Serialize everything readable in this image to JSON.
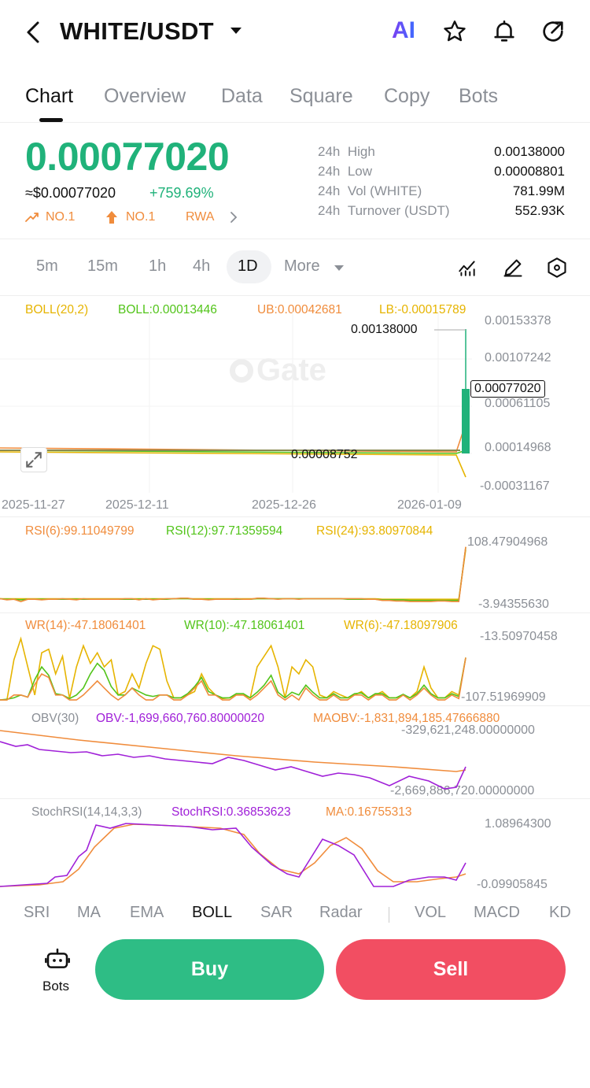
{
  "header": {
    "title": "WHITE/USDT",
    "ai_label": "AI"
  },
  "tabs": [
    {
      "label": "Chart"
    },
    {
      "label": "Overview"
    },
    {
      "label": "Data"
    },
    {
      "label": "Square"
    },
    {
      "label": "Copy"
    },
    {
      "label": "Bots"
    }
  ],
  "ticker": {
    "price": "0.00077020",
    "usd": "≈$0.00077020",
    "change": "+759.69%",
    "badges": [
      "NO.1",
      "NO.1",
      "RWA"
    ],
    "stats": [
      {
        "period": "24h",
        "label": "High",
        "value": "0.00138000"
      },
      {
        "period": "24h",
        "label": "Low",
        "value": "0.00008801"
      },
      {
        "period": "24h",
        "label": "Vol (WHITE)",
        "value": "781.99M"
      },
      {
        "period": "24h",
        "label": "Turnover (USDT)",
        "value": "552.93K"
      }
    ]
  },
  "timeframes": [
    "5m",
    "15m",
    "1h",
    "4h",
    "1D",
    "More"
  ],
  "main_chart": {
    "legend": {
      "name": "BOLL(20,2)",
      "boll": "BOLL:0.00013446",
      "ub": "UB:0.00042681",
      "lb": "LB:-0.00015789"
    },
    "watermark": "Gate",
    "y_ticks": [
      "0.00153378",
      "0.00107242",
      "0.00061105",
      "0.00014968",
      "-0.00031167"
    ],
    "high_label": "0.00138000",
    "low_label": "0.00008752",
    "current_label": "0.00077020",
    "x_ticks": [
      "2025-11-27",
      "2025-12-11",
      "2025-12-26",
      "2026-01-09"
    ]
  },
  "rsi": {
    "rsi6": "RSI(6):99.11049799",
    "rsi12": "RSI(12):97.71359594",
    "rsi24": "RSI(24):93.80970844",
    "max": "108.47904968",
    "min": "-3.94355630"
  },
  "wr": {
    "wr14": "WR(14):-47.18061401",
    "wr10": "WR(10):-47.18061401",
    "wr6": "WR(6):-47.18097906",
    "max": "-13.50970458",
    "min": "-107.51969909"
  },
  "obv": {
    "name": "OBV(30)",
    "obv": "OBV:-1,699,660,760.80000020",
    "maobv": "MAOBV:-1,831,894,185.47666880",
    "max": "-329,621,248.00000000",
    "min": "-2,669,886,720.00000000"
  },
  "stoch": {
    "name": "StochRSI(14,14,3,3)",
    "value": "StochRSI:0.36853623",
    "ma": "MA:0.16755313",
    "max": "1.08964300",
    "min": "-0.09905845"
  },
  "indicator_tabs": [
    "SRI",
    "MA",
    "EMA",
    "BOLL",
    "SAR",
    "Radar",
    "VOL",
    "MACD",
    "KD"
  ],
  "footer": {
    "bots": "Bots",
    "buy": "Buy",
    "sell": "Sell"
  },
  "colors": {
    "green": "#20b27a",
    "red": "#f24e62",
    "orange": "#f08c3c",
    "yellow": "#e6b400",
    "lime": "#52c41a",
    "purple": "#a020d8"
  },
  "series": {
    "rsi6": [
      9,
      7,
      8,
      4,
      8,
      8,
      7,
      8,
      8,
      9,
      8,
      7,
      9,
      8,
      8,
      8,
      8,
      8,
      9,
      9,
      7,
      9,
      7,
      8,
      9,
      9,
      10,
      10,
      8,
      8,
      7,
      8,
      8,
      8,
      9,
      8,
      8,
      10,
      10,
      9,
      8,
      9,
      9,
      8,
      9,
      9,
      9,
      9,
      9,
      9,
      9,
      9,
      9,
      8,
      8,
      6,
      6,
      5,
      5,
      4,
      4,
      4,
      4,
      5,
      5,
      4,
      4,
      99
    ],
    "rsi12": [
      9,
      8,
      8,
      7,
      8,
      8,
      8,
      8,
      8,
      8,
      8,
      8,
      8,
      8,
      8,
      8,
      8,
      8,
      8,
      8,
      8,
      8,
      8,
      8,
      8,
      9,
      9,
      9,
      8,
      8,
      8,
      8,
      8,
      8,
      8,
      8,
      8,
      9,
      9,
      9,
      9,
      9,
      9,
      9,
      9,
      9,
      9,
      9,
      9,
      9,
      8,
      8,
      8,
      8,
      8,
      7,
      7,
      7,
      7,
      6,
      6,
      6,
      6,
      6,
      6,
      6,
      6,
      98
    ],
    "rsi24": [
      9,
      9,
      9,
      9,
      9,
      9,
      9,
      9,
      9,
      9,
      9,
      9,
      9,
      9,
      9,
      9,
      9,
      9,
      9,
      9,
      9,
      9,
      9,
      9,
      9,
      9,
      9,
      9,
      9,
      9,
      9,
      9,
      9,
      9,
      9,
      9,
      9,
      9,
      9,
      9,
      9,
      9,
      9,
      9,
      9,
      9,
      9,
      9,
      9,
      9,
      9,
      9,
      9,
      9,
      9,
      8,
      8,
      8,
      8,
      8,
      8,
      8,
      8,
      8,
      8,
      8,
      8,
      94
    ],
    "wr14": [
      -107,
      -107,
      -100,
      -100,
      -103,
      -85,
      -70,
      -75,
      -100,
      -100,
      -107,
      -107,
      -100,
      -90,
      -80,
      -90,
      -100,
      -107,
      -100,
      -90,
      -100,
      -107,
      -107,
      -100,
      -100,
      -107,
      -107,
      -100,
      -90,
      -80,
      -100,
      -100,
      -107,
      -107,
      -100,
      -100,
      -107,
      -100,
      -90,
      -80,
      -100,
      -107,
      -100,
      -107,
      -90,
      -100,
      -107,
      -107,
      -100,
      -107,
      -107,
      -100,
      -100,
      -107,
      -100,
      -100,
      -107,
      -107,
      -100,
      -107,
      -100,
      -90,
      -100,
      -107,
      -107,
      -100,
      -105,
      -47
    ],
    "wr10": [
      -107,
      -106,
      -104,
      -100,
      -103,
      -78,
      -60,
      -72,
      -98,
      -100,
      -105,
      -100,
      -90,
      -70,
      -55,
      -65,
      -88,
      -100,
      -100,
      -90,
      -95,
      -100,
      -102,
      -100,
      -100,
      -104,
      -104,
      -98,
      -88,
      -75,
      -95,
      -100,
      -104,
      -104,
      -98,
      -98,
      -104,
      -96,
      -86,
      -72,
      -96,
      -104,
      -96,
      -100,
      -86,
      -96,
      -104,
      -104,
      -98,
      -104,
      -104,
      -98,
      -97,
      -104,
      -98,
      -98,
      -104,
      -104,
      -99,
      -104,
      -98,
      -86,
      -98,
      -104,
      -104,
      -98,
      -102,
      -47
    ],
    "wr6": [
      -107,
      -107,
      -50,
      -20,
      -60,
      -100,
      -40,
      -35,
      -70,
      -45,
      -105,
      -60,
      -30,
      -55,
      -40,
      -60,
      -50,
      -100,
      -95,
      -70,
      -90,
      -55,
      -30,
      -35,
      -80,
      -104,
      -104,
      -100,
      -95,
      -70,
      -90,
      -100,
      -105,
      -104,
      -100,
      -100,
      -104,
      -60,
      -45,
      -30,
      -60,
      -104,
      -60,
      -70,
      -50,
      -60,
      -100,
      -104,
      -95,
      -100,
      -104,
      -100,
      -95,
      -104,
      -100,
      -95,
      -104,
      -104,
      -100,
      -104,
      -95,
      -60,
      -90,
      -104,
      -104,
      -95,
      -100,
      -47
    ]
  }
}
